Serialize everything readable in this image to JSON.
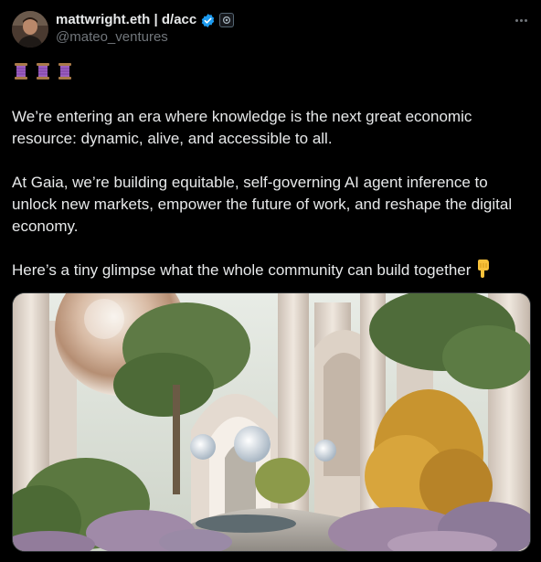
{
  "author": {
    "display_name": "mattwright.eth | d/acc",
    "handle": "@mateo_ventures",
    "verified": true,
    "avatar_icon": "profile-photo",
    "affiliate_badge_icon": "gear-badge-icon"
  },
  "post": {
    "emoji_prefix": [
      "spool-of-thread",
      "spool-of-thread",
      "spool-of-thread"
    ],
    "paragraphs": [
      "We’re entering an era where knowledge is the next great economic resource: dynamic, alive, and accessible to all.",
      "At Gaia, we’re building equitable, self-governing AI agent inference to unlock new markets, empower the future of work, and reshape the digital economy.",
      "Here’s a tiny glimpse what the whole community can build together"
    ],
    "trailing_emoji": "pointing-down-hand",
    "media_description_icon": "futuristic-garden-image"
  },
  "colors": {
    "background": "#000000",
    "text_primary": "#e7e9ea",
    "text_secondary": "#71767b",
    "verified_blue": "#1d9bf0"
  }
}
